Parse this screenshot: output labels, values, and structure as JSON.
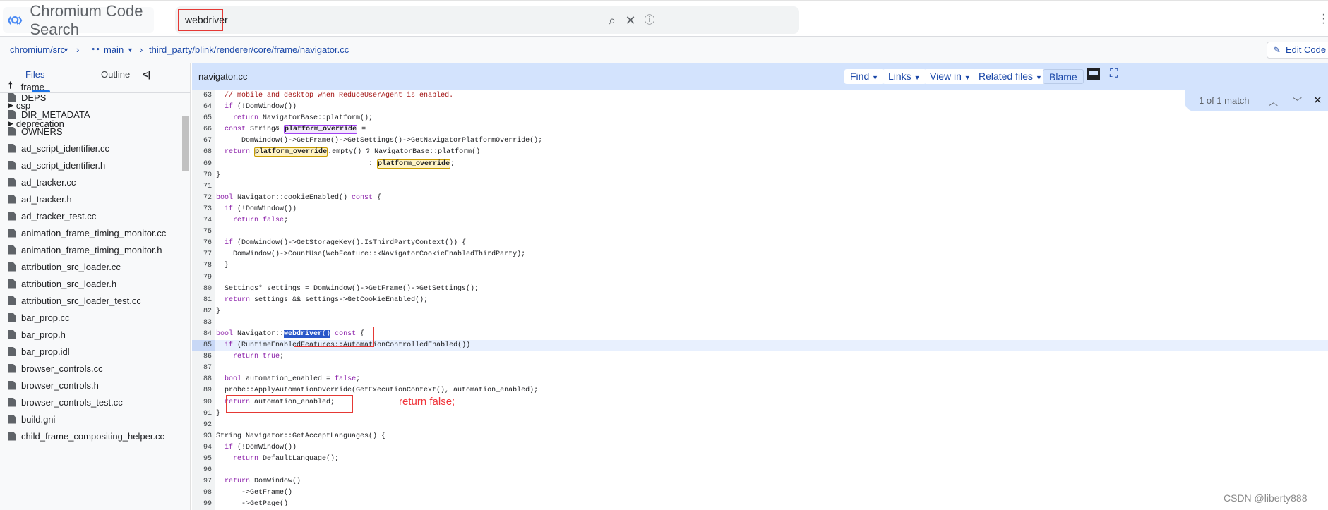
{
  "header": {
    "title": "Chromium Code Search",
    "search_value": "webdriver",
    "icons": [
      "search-icon",
      "clear-icon",
      "info-icon",
      "more-vert-icon"
    ]
  },
  "breadcrumb": {
    "repo": "chromium/src",
    "branch": "main",
    "path": "third_party/blink/renderer/core/frame/navigator.cc",
    "edit_label": "Edit Code"
  },
  "sidebar": {
    "tabs": [
      "Files",
      "Outline"
    ],
    "parent": "frame",
    "folders": [
      "csp",
      "deprecation"
    ],
    "files": [
      "DEPS",
      "DIR_METADATA",
      "OWNERS",
      "ad_script_identifier.cc",
      "ad_script_identifier.h",
      "ad_tracker.cc",
      "ad_tracker.h",
      "ad_tracker_test.cc",
      "animation_frame_timing_monitor.cc",
      "animation_frame_timing_monitor.h",
      "attribution_src_loader.cc",
      "attribution_src_loader.h",
      "attribution_src_loader_test.cc",
      "bar_prop.cc",
      "bar_prop.h",
      "bar_prop.idl",
      "browser_controls.cc",
      "browser_controls.h",
      "browser_controls_test.cc",
      "build.gni",
      "child_frame_compositing_helper.cc"
    ]
  },
  "file_header": {
    "name": "navigator.cc",
    "buttons": [
      "Find",
      "Links",
      "View in",
      "Related files"
    ],
    "blame": "Blame"
  },
  "match": {
    "text": "1 of 1 match"
  },
  "code": [
    {
      "n": "63",
      "s": [
        [
          "",
          "  "
        ],
        [
          "c",
          "// mobile and desktop when ReduceUserAgent is enabled."
        ]
      ]
    },
    {
      "n": "64",
      "s": [
        [
          "",
          "  "
        ],
        [
          "k",
          "if"
        ],
        [
          "",
          " (!DomWindow())"
        ]
      ]
    },
    {
      "n": "65",
      "s": [
        [
          "",
          "    "
        ],
        [
          "k",
          "return"
        ],
        [
          "",
          " NavigatorBase::platform();"
        ]
      ]
    },
    {
      "n": "66",
      "s": [
        [
          "",
          "  "
        ],
        [
          "k",
          "const"
        ],
        [
          "",
          " String& "
        ],
        [
          "h1",
          "platform_override"
        ],
        [
          "",
          " ="
        ]
      ]
    },
    {
      "n": "67",
      "s": [
        [
          "",
          "      DomWindow()->GetFrame()->GetSettings()->GetNavigatorPlatformOverride();"
        ]
      ]
    },
    {
      "n": "68",
      "s": [
        [
          "",
          "  "
        ],
        [
          "k",
          "return"
        ],
        [
          "",
          " "
        ],
        [
          "h2",
          "platform_override"
        ],
        [
          "",
          ".empty() ? NavigatorBase::platform()"
        ]
      ]
    },
    {
      "n": "69",
      "s": [
        [
          "",
          "                                    : "
        ],
        [
          "h2",
          "platform_override"
        ],
        [
          "",
          ";"
        ]
      ]
    },
    {
      "n": "70",
      "s": [
        [
          "",
          "}"
        ]
      ]
    },
    {
      "n": "71",
      "s": []
    },
    {
      "n": "72",
      "s": [
        [
          "k",
          "bool"
        ],
        [
          "",
          " Navigator::cookieEnabled() "
        ],
        [
          "k",
          "const"
        ],
        [
          "",
          " {"
        ]
      ]
    },
    {
      "n": "73",
      "s": [
        [
          "",
          "  "
        ],
        [
          "k",
          "if"
        ],
        [
          "",
          " (!DomWindow())"
        ]
      ]
    },
    {
      "n": "74",
      "s": [
        [
          "",
          "    "
        ],
        [
          "k",
          "return"
        ],
        [
          "",
          " "
        ],
        [
          "k",
          "false"
        ],
        [
          "",
          ";"
        ]
      ]
    },
    {
      "n": "75",
      "s": []
    },
    {
      "n": "76",
      "s": [
        [
          "",
          "  "
        ],
        [
          "k",
          "if"
        ],
        [
          "",
          " (DomWindow()->GetStorageKey().IsThirdPartyContext()) {"
        ]
      ]
    },
    {
      "n": "77",
      "s": [
        [
          "",
          "    DomWindow()->CountUse(WebFeature::kNavigatorCookieEnabledThirdParty);"
        ]
      ]
    },
    {
      "n": "78",
      "s": [
        [
          "",
          "  }"
        ]
      ]
    },
    {
      "n": "79",
      "s": []
    },
    {
      "n": "80",
      "s": [
        [
          "",
          "  Settings* settings = DomWindow()->GetFrame()->GetSettings();"
        ]
      ]
    },
    {
      "n": "81",
      "s": [
        [
          "",
          "  "
        ],
        [
          "k",
          "return"
        ],
        [
          "",
          " settings && settings->GetCookieEnabled();"
        ]
      ]
    },
    {
      "n": "82",
      "s": [
        [
          "",
          "}"
        ]
      ]
    },
    {
      "n": "83",
      "s": []
    },
    {
      "n": "84",
      "s": [
        [
          "k",
          "bool"
        ],
        [
          "",
          " Navigator::"
        ],
        [
          "sel",
          "webdriver"
        ],
        [
          "sel2",
          "()"
        ],
        [
          "",
          " "
        ],
        [
          "k",
          "const"
        ],
        [
          "",
          " {"
        ]
      ]
    },
    {
      "n": "85",
      "s": [
        [
          "",
          "  "
        ],
        [
          "k",
          "if"
        ],
        [
          "",
          " (RuntimeEnabledFeatures::AutomationControlledEnabled())"
        ]
      ],
      "current": true
    },
    {
      "n": "86",
      "s": [
        [
          "",
          "    "
        ],
        [
          "k",
          "return"
        ],
        [
          "",
          " "
        ],
        [
          "k",
          "true"
        ],
        [
          "",
          ";"
        ]
      ]
    },
    {
      "n": "87",
      "s": []
    },
    {
      "n": "88",
      "s": [
        [
          "",
          "  "
        ],
        [
          "k",
          "bool"
        ],
        [
          "",
          " automation_enabled = "
        ],
        [
          "k",
          "false"
        ],
        [
          "",
          ";"
        ]
      ]
    },
    {
      "n": "89",
      "s": [
        [
          "",
          "  probe::ApplyAutomationOverride(GetExecutionContext(), automation_enabled);"
        ]
      ]
    },
    {
      "n": "90",
      "s": [
        [
          "",
          "  "
        ],
        [
          "k",
          "return"
        ],
        [
          "",
          " automation_enabled;"
        ]
      ]
    },
    {
      "n": "91",
      "s": [
        [
          "",
          "}"
        ]
      ]
    },
    {
      "n": "92",
      "s": []
    },
    {
      "n": "93",
      "s": [
        [
          "",
          "String Navigator::GetAcceptLanguages() {"
        ]
      ]
    },
    {
      "n": "94",
      "s": [
        [
          "",
          "  "
        ],
        [
          "k",
          "if"
        ],
        [
          "",
          " (!DomWindow())"
        ]
      ]
    },
    {
      "n": "95",
      "s": [
        [
          "",
          "    "
        ],
        [
          "k",
          "return"
        ],
        [
          "",
          " DefaultLanguage();"
        ]
      ]
    },
    {
      "n": "96",
      "s": []
    },
    {
      "n": "97",
      "s": [
        [
          "",
          "  "
        ],
        [
          "k",
          "return"
        ],
        [
          "",
          " DomWindow()"
        ]
      ]
    },
    {
      "n": "98",
      "s": [
        [
          "",
          "      ->GetFrame()"
        ]
      ]
    },
    {
      "n": "99",
      "s": [
        [
          "",
          "      ->GetPage()"
        ]
      ]
    }
  ],
  "annotation": {
    "text": "return false;",
    "color": "#f0343a"
  },
  "watermark": "CSDN @liberty888"
}
